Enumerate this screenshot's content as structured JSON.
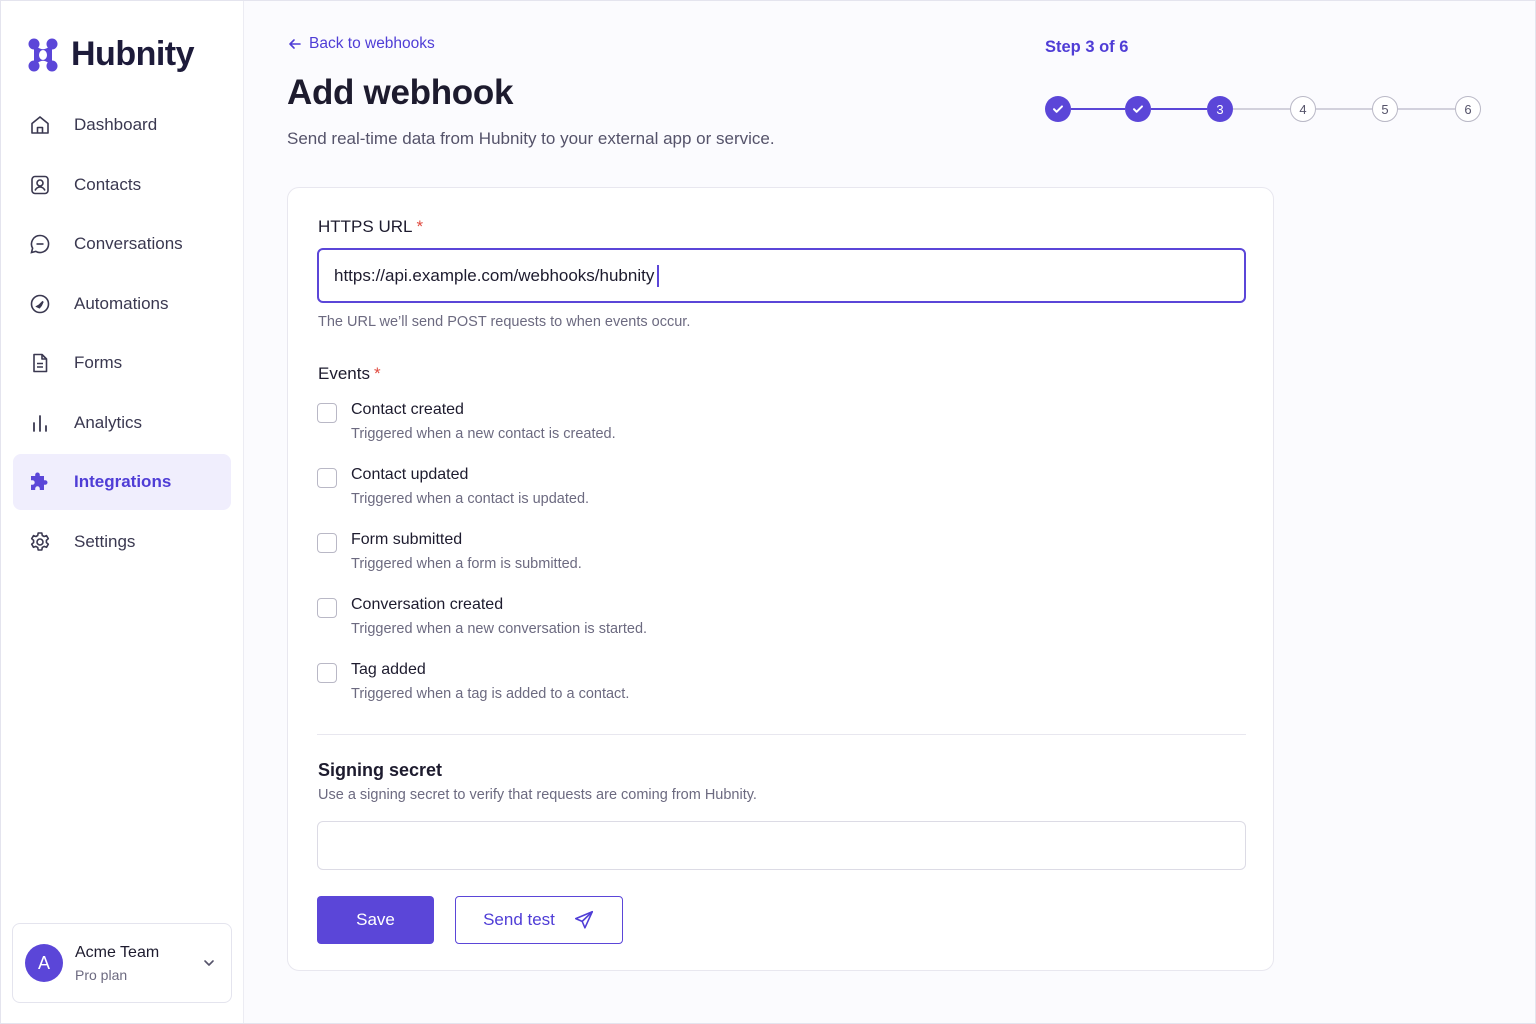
{
  "brand": {
    "name": "Hubnity",
    "accent": "#5b46d8"
  },
  "sidebar": {
    "items": [
      {
        "label": "Dashboard",
        "icon": "home-icon"
      },
      {
        "label": "Contacts",
        "icon": "contact-card-icon"
      },
      {
        "label": "Conversations",
        "icon": "chat-bubble-icon"
      },
      {
        "label": "Automations",
        "icon": "automation-icon"
      },
      {
        "label": "Forms",
        "icon": "document-icon"
      },
      {
        "label": "Analytics",
        "icon": "bar-chart-icon"
      },
      {
        "label": "Integrations",
        "icon": "puzzle-icon",
        "active": true
      },
      {
        "label": "Settings",
        "icon": "gear-icon"
      }
    ]
  },
  "account": {
    "initial": "A",
    "name": "Acme Team",
    "plan": "Pro plan"
  },
  "header": {
    "back_label": "Back to webhooks",
    "title": "Add webhook",
    "subtitle": "Send real-time data from Hubnity to your external app or service.",
    "step_label": "Step 3 of 6",
    "steps": [
      "1",
      "2",
      "3",
      "4",
      "5",
      "6"
    ],
    "current_step": 3
  },
  "form": {
    "url_label": "HTTPS URL",
    "required_mark": "*",
    "url_value": "https://api.example.com/webhooks/hubnity",
    "url_hint": "The URL we’ll send POST requests to when events occur.",
    "events_label": "Events",
    "events": [
      {
        "title": "Contact created",
        "desc": "Triggered when a new contact is created."
      },
      {
        "title": "Contact updated",
        "desc": "Triggered when a contact is updated."
      },
      {
        "title": "Form submitted",
        "desc": "Triggered when a form is submitted."
      },
      {
        "title": "Conversation created",
        "desc": "Triggered when a new conversation is started."
      },
      {
        "title": "Tag added",
        "desc": "Triggered when a tag is added to a contact."
      }
    ],
    "secret_title": "Signing secret",
    "secret_hint": "Use a signing secret to verify that requests are coming from Hubnity.",
    "secret_value": "",
    "save_label": "Save",
    "test_label": "Send test"
  }
}
